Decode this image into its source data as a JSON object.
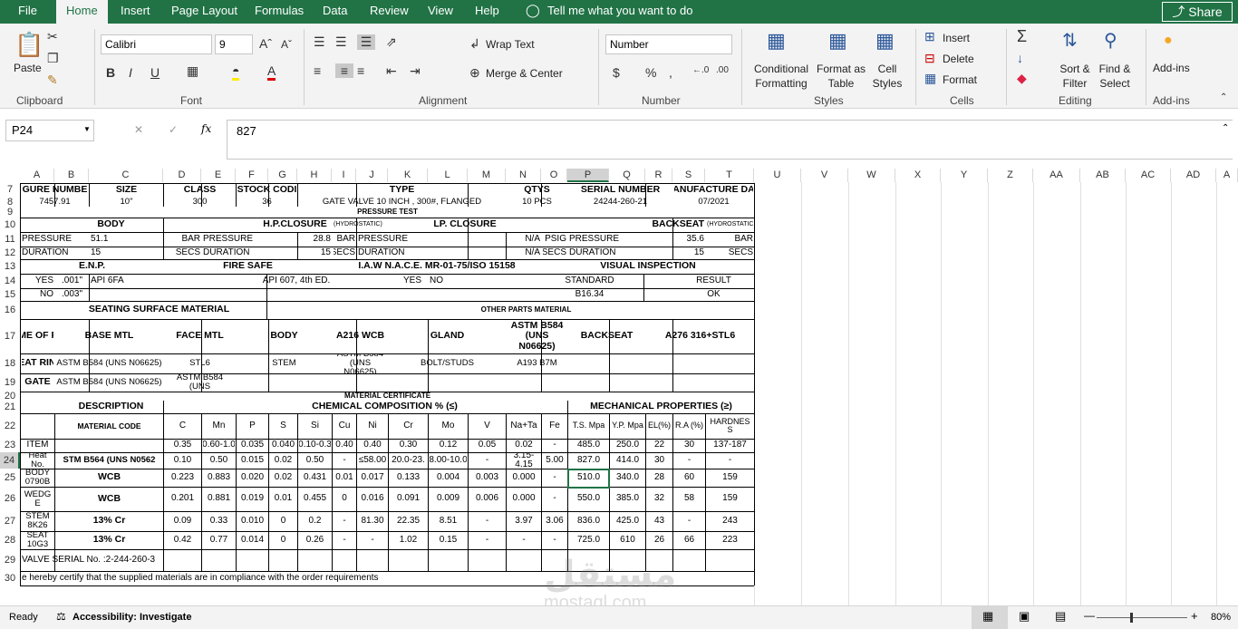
{
  "menu": {
    "tabs": [
      "File",
      "Home",
      "Insert",
      "Page Layout",
      "Formulas",
      "Data",
      "Review",
      "View",
      "Help"
    ],
    "active": "Home",
    "tell_me": "Tell me what you want to do",
    "share": "Share"
  },
  "ribbon": {
    "clipboard": {
      "label": "Clipboard",
      "paste": "Paste"
    },
    "font": {
      "label": "Font",
      "name": "Calibri",
      "size": "9",
      "bold": "B",
      "italic": "I",
      "underline": "U"
    },
    "alignment": {
      "label": "Alignment",
      "wrap": "Wrap Text",
      "merge": "Merge & Center"
    },
    "number": {
      "label": "Number",
      "format": "Number",
      "currency": "$",
      "percent": "%",
      "comma": ","
    },
    "styles": {
      "label": "Styles",
      "conditional": "Conditional Formatting",
      "format_table": "Format as Table",
      "cell_styles": "Cell Styles"
    },
    "cells": {
      "label": "Cells",
      "insert": "Insert",
      "delete": "Delete",
      "format": "Format"
    },
    "editing": {
      "label": "Editing",
      "sort": "Sort & Filter",
      "find": "Find & Select"
    },
    "addins": {
      "label": "Add-ins",
      "btn": "Add-ins"
    }
  },
  "formula_bar": {
    "name_box": "P24",
    "fx": "fx",
    "value": "827"
  },
  "columns": [
    "A",
    "B",
    "C",
    "D",
    "E",
    "F",
    "G",
    "H",
    "I",
    "J",
    "K",
    "L",
    "M",
    "N",
    "O",
    "P",
    "Q",
    "R",
    "S",
    "T",
    "U",
    "V",
    "W",
    "X",
    "Y",
    "Z",
    "AA",
    "AB",
    "AC",
    "AD",
    "A"
  ],
  "rows": [
    "7",
    "8",
    "9",
    "10",
    "11",
    "12",
    "13",
    "14",
    "15",
    "16",
    "17",
    "18",
    "19",
    "20",
    "21",
    "22",
    "23",
    "24",
    "25",
    "26",
    "27",
    "28",
    "29",
    "30"
  ],
  "sheet": {
    "r7": [
      "GURE NUMBE",
      "SIZE",
      "CLASS",
      "STOCK CODI",
      "TYPE",
      "QTYS",
      "SERIAL NUMBER",
      "ANUFACTURE DA"
    ],
    "r8": [
      "7457.91",
      "10\"",
      "300",
      "36",
      "GATE VALVE 10 INCH , 300#, FLANGED",
      "10 PCS",
      "24244-260-21",
      "07/2021"
    ],
    "r9": "PRESSURE TEST",
    "r10": [
      "BODY",
      "H.P.CLOSURE",
      "(HYDROSTATIC)",
      "LP. CLOSURE",
      "BACKSEAT",
      "(HYDROSTATIC)"
    ],
    "r11": [
      "PRESSURE",
      "51.1",
      "BAR",
      "PRESSURE",
      "28.8",
      "BAR",
      "PRESSURE",
      "N/A",
      "PSIG",
      "PRESSURE",
      "35.6",
      "BAR"
    ],
    "r12": [
      "DURATION",
      "15",
      "SECS",
      "DURATION",
      "15",
      "SECS",
      "DURATION",
      "N/A",
      "SECS",
      "DURATION",
      "15",
      "SECS"
    ],
    "r13": [
      "E.N.P.",
      "FIRE SAFE",
      "I.A.W N.A.C.E. MR-01-75/ISO 15158",
      "VISUAL INSPECTION"
    ],
    "r14": [
      "YES",
      ".001\"",
      "API 6FA",
      "API 607, 4th ED.",
      "YES",
      "NO",
      "STANDARD",
      "RESULT"
    ],
    "r15": [
      "NO",
      ".003\"",
      "B16.34",
      "OK"
    ],
    "r16": [
      "SEATING SURFACE MATERIAL",
      "OTHER PARTS MATERIAL"
    ],
    "r17": [
      "NAME OF PAR",
      "BASE MTL",
      "FACE MTL",
      "BODY",
      "A216 WCB",
      "GLAND",
      "ASTM B584 (UNS N06625)",
      "BACKSEAT",
      "A276 316+STL6"
    ],
    "r18": [
      "SEAT RING",
      "ASTM B584 (UNS N06625)",
      "STL6",
      "STEM",
      "ASTM B584 (UNS N06625)",
      "BOLT/STUDS",
      "A193 B7M"
    ],
    "r19": [
      "GATE",
      "ASTM B584 (UNS N06625)",
      "ASTM B584 (UNS"
    ],
    "r20": "MATERIAL CERTIFICATE",
    "r21": [
      "DESCRIPTION",
      "CHEMICAL COMPOSITION % (≤)",
      "MECHANICAL PROPERTIES (≥)"
    ],
    "r22": [
      "MATERIAL CODE",
      "C",
      "Mn",
      "P",
      "S",
      "Si",
      "Cu",
      "Ni",
      "Cr",
      "Mo",
      "V",
      "Na+Ta",
      "Fe",
      "T.S. Mpa",
      "Y.P. Mpa",
      "EL(%)",
      "R.A (%)",
      "HARDNES S"
    ],
    "r23": [
      "ITEM",
      "0.35",
      "0.60-1.0",
      "0.035",
      "0.040",
      "0.10-0.3",
      "0.40",
      "0.40",
      "0.30",
      "0.12",
      "0.05",
      "0.02",
      "-",
      "485.0",
      "250.0",
      "22",
      "30",
      "137-187"
    ],
    "r24": [
      "Heat No.",
      "STM B564 (UNS N0562",
      "0.10",
      "0.50",
      "0.015",
      "0.02",
      "0.50",
      "-",
      "≤58.00",
      "20.0-23.",
      "8.00-10.0",
      "-",
      "3.15-4.15",
      "5.00",
      "827.0",
      "414.0",
      "30",
      "-",
      "-"
    ],
    "r25": [
      "BODY 0790B",
      "WCB",
      "0.223",
      "0.883",
      "0.020",
      "0.02",
      "0.431",
      "0.01",
      "0.017",
      "0.133",
      "0.004",
      "0.003",
      "0.000",
      "-",
      "510.0",
      "340.0",
      "28",
      "60",
      "159"
    ],
    "r26": [
      "WEDG E",
      "WCB",
      "0.201",
      "0.881",
      "0.019",
      "0.01",
      "0.455",
      "0",
      "0.016",
      "0.091",
      "0.009",
      "0.006",
      "0.000",
      "-",
      "550.0",
      "385.0",
      "32",
      "58",
      "159"
    ],
    "r27": [
      "STEM 8K26",
      "13% Cr",
      "0.09",
      "0.33",
      "0.010",
      "0",
      "0.2",
      "-",
      "81.30",
      "22.35",
      "8.51",
      "-",
      "3.97",
      "3.06",
      "836.0",
      "425.0",
      "43",
      "-",
      "243"
    ],
    "r28": [
      "SEAT 10G3",
      "13% Cr",
      "0.42",
      "0.77",
      "0.014",
      "0",
      "0.26",
      "-",
      "-",
      "1.02",
      "0.15",
      "-",
      "-",
      "-",
      "725.0",
      "610",
      "26",
      "66",
      "223"
    ],
    "r29": "VALVE SERIAL No. :2-244-260-3",
    "r30": "e hereby certify that the supplied materials are in compliance with the order requirements"
  },
  "status": {
    "ready": "Ready",
    "accessibility": "Accessibility: Investigate",
    "zoom": "80%"
  },
  "watermark": {
    "arabic": "مستقل",
    "latin": "mostaql.com"
  }
}
